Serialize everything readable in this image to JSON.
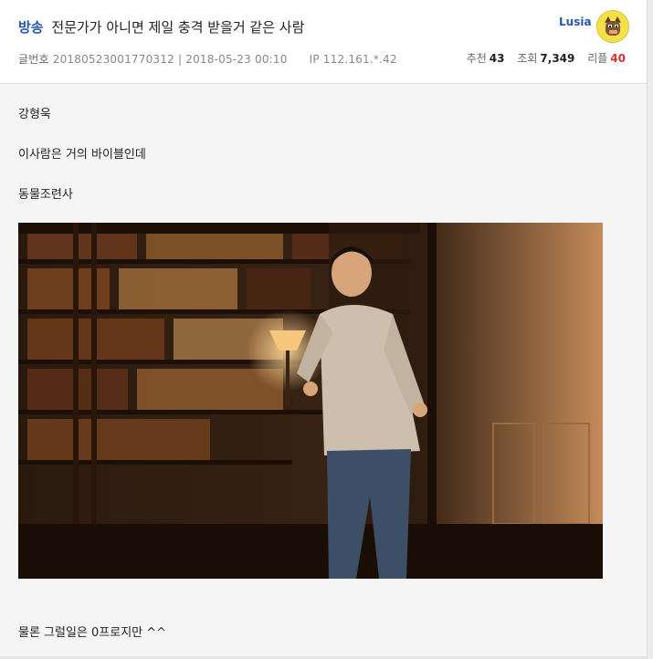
{
  "post": {
    "category": "방송",
    "title": "전문가가 아니면 제일 충격 받을거 같은 사람",
    "author": "Lusia",
    "number_label": "글번호",
    "number": "20180523001770312",
    "date": "2018-05-23 00:10",
    "ip_label": "IP",
    "ip": "112.161.*.42",
    "recommend_label": "추천",
    "recommend": "43",
    "views_label": "조회",
    "views": "7,349",
    "replies_label": "리플",
    "replies": "40"
  },
  "content": {
    "lines": [
      " 강형욱",
      "이사람은 거의 바이블인데",
      "동물조련사"
    ],
    "after_image": "물론 그럴일은 0프로지만 ^^"
  },
  "colors": {
    "category": "#2a56b0",
    "replies": "#d9302a",
    "content_bg": "#f5f5f5"
  },
  "icons": {
    "avatar": "tiger-avatar-icon"
  }
}
